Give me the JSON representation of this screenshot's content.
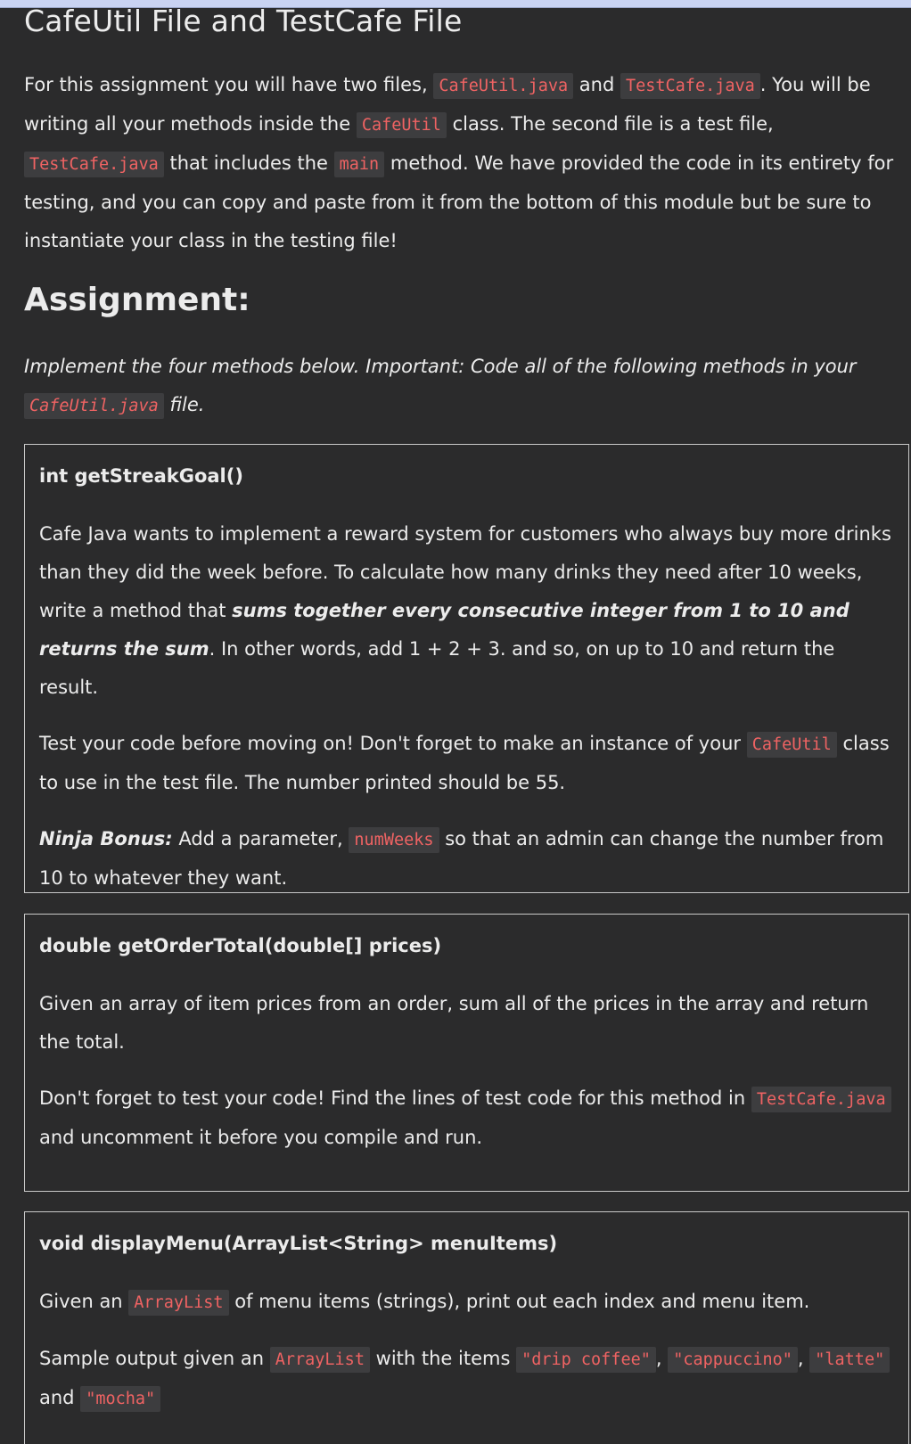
{
  "title": "CafeUtil File and TestCafe File",
  "intro": {
    "t1": "For this assignment you will have two files, ",
    "c1": "CafeUtil.java",
    "t2": " and ",
    "c2": "TestCafe.java",
    "t3": ". You will be writing all your methods inside the ",
    "c3": "CafeUtil",
    "t4": " class. The second file is a test file, ",
    "c4": "TestCafe.java",
    "t5": " that includes the ",
    "c5": "main",
    "t6": " method. We have provided the code in its entirety for testing, and you can copy and paste from it from the bottom of this module but be sure to instantiate your class in the testing file!"
  },
  "assignment_heading": "Assignment:",
  "instruction": {
    "t1": "Implement the four methods below. Important: Code all of the following methods in your ",
    "c1": "CafeUtil.java",
    "t2": " file."
  },
  "box1": {
    "heading": "int getStreakGoal()",
    "p1_t1": "Cafe Java wants to implement a reward system for customers who always buy more drinks than they did the week before. To calculate how many drinks they need after 10 weeks, write a method that ",
    "p1_b": "sums together every consecutive integer from 1 to 10 and returns the sum",
    "p1_t2": ". In other words, add 1 + 2 + 3. and so, on up to 10 and return the result.",
    "p2_t1": "Test your code before moving on! Don't forget to make an instance of your ",
    "p2_c": "CafeUtil",
    "p2_t2": " class to use in the test file. The number printed should be 55.",
    "p3_b": "Ninja Bonus:",
    "p3_t1": " Add a parameter, ",
    "p3_c": "numWeeks",
    "p3_t2": " so that an admin can change the number from 10 to whatever they want."
  },
  "box2": {
    "heading": "double getOrderTotal(double[] prices)",
    "p1": "Given an array of item prices from an order, sum all of the prices in the array and return the total.",
    "p2_t1": "Don't forget to test your code! Find the lines of test code for this method in ",
    "p2_c": "TestCafe.java",
    "p2_t2": " and uncomment it before you compile and run."
  },
  "box3": {
    "heading": "void displayMenu(ArrayList<String> menuItems)",
    "p1_t1": "Given an ",
    "p1_c": "ArrayList",
    "p1_t2": " of menu items (strings), print out each index and menu item.",
    "p2_t1": "Sample output given an ",
    "p2_c1": "ArrayList",
    "p2_t2": " with the items ",
    "p2_c2": "\"drip coffee\"",
    "p2_s1": ", ",
    "p2_c3": "\"cappuccino\"",
    "p2_s2": ", ",
    "p2_c4": "\"latte\"",
    "p2_t3": " and ",
    "p2_c5": "\"mocha\""
  }
}
